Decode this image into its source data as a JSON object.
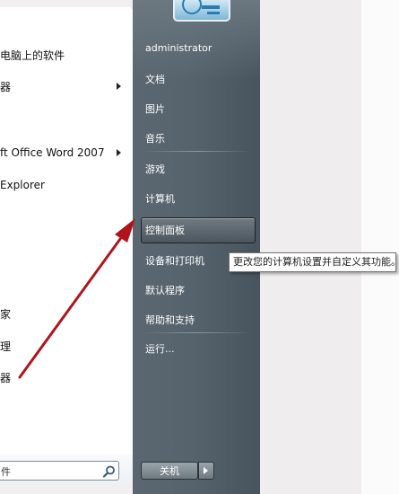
{
  "left_panel": {
    "items": [
      {
        "label": "电脑上的软件",
        "arrow": false
      },
      {
        "label": "器",
        "arrow": true
      },
      {
        "label": "ft Office Word 2007",
        "arrow": true
      },
      {
        "label": "Explorer",
        "arrow": false
      },
      {
        "label": "家",
        "arrow": false
      },
      {
        "label": "理",
        "arrow": false
      },
      {
        "label": "器",
        "arrow": false
      }
    ],
    "search": {
      "value": "件",
      "icon": "search-icon"
    }
  },
  "right_panel": {
    "user_name": "administrator",
    "items": [
      {
        "id": "documents",
        "label": "文档"
      },
      {
        "id": "pictures",
        "label": "图片"
      },
      {
        "id": "music",
        "label": "音乐"
      },
      {
        "id": "games",
        "label": "游戏"
      },
      {
        "id": "computer",
        "label": "计算机"
      },
      {
        "id": "control-panel",
        "label": "控制面板",
        "highlighted": true
      },
      {
        "id": "devices-printers",
        "label": "设备和打印机"
      },
      {
        "id": "default-programs",
        "label": "默认程序"
      },
      {
        "id": "help-support",
        "label": "帮助和支持"
      },
      {
        "id": "run",
        "label": "运行..."
      }
    ],
    "shutdown": {
      "label": "关机",
      "arrow_icon": "chevron-right-icon"
    }
  },
  "tooltip": {
    "text": "更改您的计算机设置并自定义其功能。"
  },
  "colors": {
    "panel_dark": "#56636d",
    "annotation_arrow": "#b0141b",
    "tooltip_border": "#767676"
  }
}
